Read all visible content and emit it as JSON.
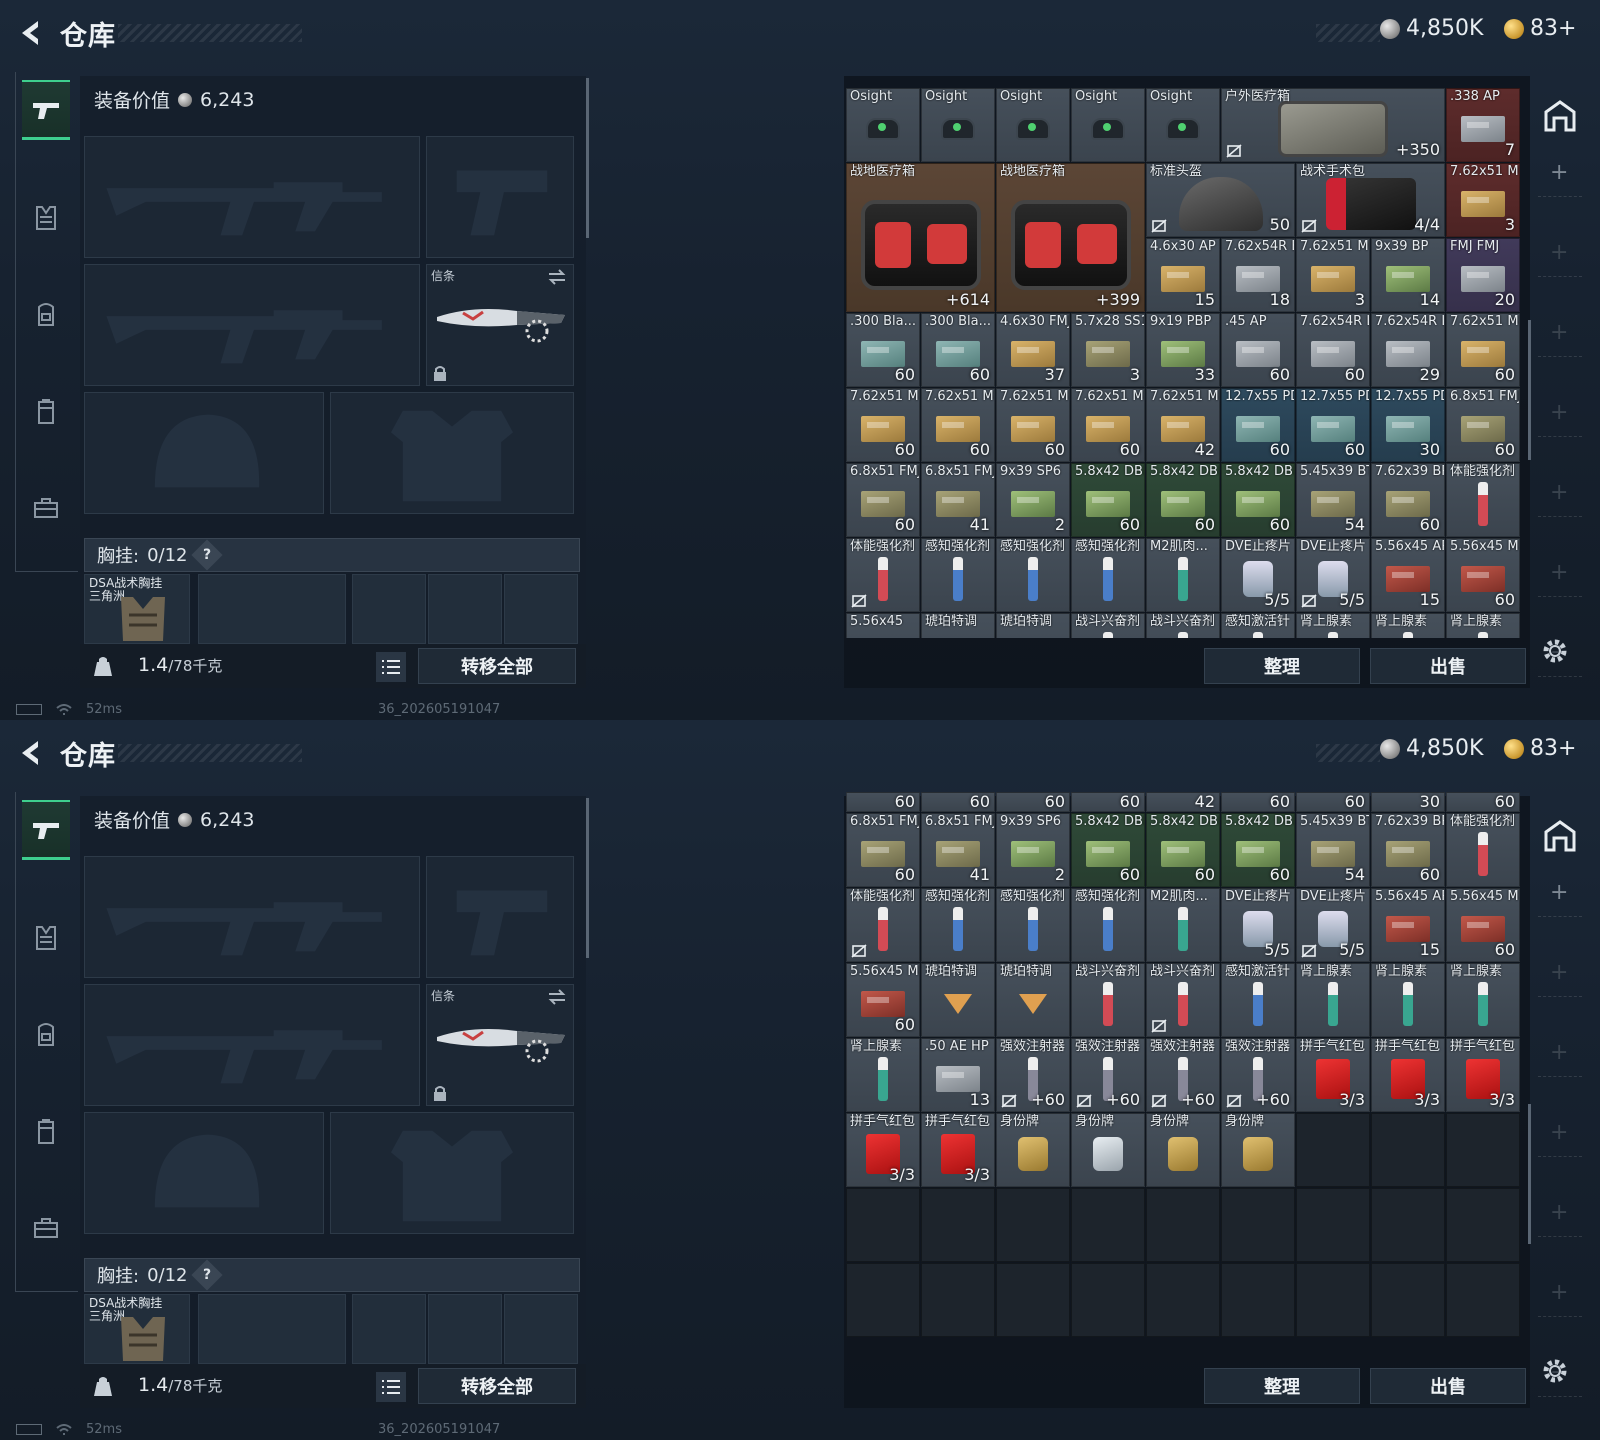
{
  "header": {
    "title": "仓库",
    "silver": "4,850K",
    "gold": "83+"
  },
  "equipment": {
    "value_label": "装备价值",
    "value": "6,243",
    "melee_label": "信条",
    "chest_label": "胸挂:",
    "chest_count": "0/12",
    "chest_help": "?",
    "rig_name": "DSA战术胸挂",
    "rig_sub": "三角洲",
    "weight": "1.4",
    "weight_max": "/78千克",
    "transfer_all": "转移全部"
  },
  "stash": {
    "sort_button": "整理",
    "sell_button": "出售"
  },
  "status": {
    "ping": "52ms",
    "build": "36_202605191047"
  },
  "stash_view_1": [
    {
      "r": 0,
      "c": 0,
      "n": "Osight",
      "i": "optic",
      "bg": "gray"
    },
    {
      "r": 0,
      "c": 1,
      "n": "Osight",
      "i": "optic",
      "bg": "gray"
    },
    {
      "r": 0,
      "c": 2,
      "n": "Osight",
      "i": "optic",
      "bg": "gray"
    },
    {
      "r": 0,
      "c": 3,
      "n": "Osight",
      "i": "optic",
      "bg": "gray"
    },
    {
      "r": 0,
      "c": 4,
      "n": "Osight",
      "i": "optic",
      "bg": "gray"
    },
    {
      "r": 0,
      "c": 5,
      "w": 3,
      "n": "户外医疗箱",
      "i": "case",
      "bg": "gray",
      "ct": "+350",
      "nk": true
    },
    {
      "r": 0,
      "c": 8,
      "n": ".338 AP",
      "i": "ammo-gray",
      "bg": "red",
      "ct": "7"
    },
    {
      "r": 1,
      "c": 0,
      "w": 2,
      "h": 2,
      "n": "战地医疗箱",
      "i": "bigmed",
      "bg": "brown",
      "ct": "+614"
    },
    {
      "r": 1,
      "c": 2,
      "w": 2,
      "h": 2,
      "n": "战地医疗箱",
      "i": "bigmed",
      "bg": "brown",
      "ct": "+399"
    },
    {
      "r": 1,
      "c": 4,
      "w": 2,
      "n": "标准头盔",
      "i": "helmet",
      "bg": "gray",
      "ct": "50",
      "nk": true
    },
    {
      "r": 1,
      "c": 6,
      "w": 2,
      "n": "战术手术包",
      "i": "kit",
      "bg": "gray",
      "ct": "4/4",
      "nk": true
    },
    {
      "r": 1,
      "c": 8,
      "n": "7.62x51 M61",
      "i": "ammo-tan",
      "bg": "red",
      "ct": "3"
    },
    {
      "r": 2,
      "c": 4,
      "n": "4.6x30 AP SX",
      "i": "ammo-tan",
      "bg": "gray",
      "ct": "15"
    },
    {
      "r": 2,
      "c": 5,
      "n": "7.62x54R BT",
      "i": "ammo-gray",
      "bg": "gray",
      "ct": "18"
    },
    {
      "r": 2,
      "c": 6,
      "n": "7.62x51 M62",
      "i": "ammo-tan",
      "bg": "gray",
      "ct": "3"
    },
    {
      "r": 2,
      "c": 7,
      "n": "9x39 BP",
      "i": "ammo-green",
      "bg": "gray",
      "ct": "14"
    },
    {
      "r": 2,
      "c": 8,
      "n": "FMJ FMJ",
      "i": "ammo-gray",
      "bg": "purple",
      "ct": "20"
    },
    {
      "r": 3,
      "c": 0,
      "n": ".300 Bla... BCP FMJ",
      "i": "ammo-teal",
      "bg": "gray",
      "ct": "60"
    },
    {
      "r": 3,
      "c": 1,
      "n": ".300 Bla... BCP FMJ",
      "i": "ammo-teal",
      "bg": "gray",
      "ct": "60"
    },
    {
      "r": 3,
      "c": 2,
      "n": "4.6x30 FMJ SX",
      "i": "ammo-tan",
      "bg": "gray",
      "ct": "37"
    },
    {
      "r": 3,
      "c": 3,
      "n": "5.7x28 SS190",
      "i": "ammo-olive",
      "bg": "gray",
      "ct": "3"
    },
    {
      "r": 3,
      "c": 4,
      "n": "9x19 PBP",
      "i": "ammo-green",
      "bg": "gray",
      "ct": "33"
    },
    {
      "r": 3,
      "c": 5,
      "n": ".45 AP",
      "i": "ammo-gray",
      "bg": "gray",
      "ct": "60"
    },
    {
      "r": 3,
      "c": 6,
      "n": "7.62x54R LPS",
      "i": "ammo-gray",
      "bg": "gray",
      "ct": "60"
    },
    {
      "r": 3,
      "c": 7,
      "n": "7.62x54R LPS",
      "i": "ammo-gray",
      "bg": "gray",
      "ct": "29"
    },
    {
      "r": 3,
      "c": 8,
      "n": "7.62x51 M80",
      "i": "ammo-tan",
      "bg": "gray",
      "ct": "60"
    },
    {
      "r": 4,
      "c": 0,
      "n": "7.62x51 M80",
      "i": "ammo-tan",
      "bg": "gray",
      "ct": "60"
    },
    {
      "r": 4,
      "c": 1,
      "n": "7.62x51 M80",
      "i": "ammo-tan",
      "bg": "gray",
      "ct": "60"
    },
    {
      "r": 4,
      "c": 2,
      "n": "7.62x51 M80",
      "i": "ammo-tan",
      "bg": "gray",
      "ct": "60"
    },
    {
      "r": 4,
      "c": 3,
      "n": "7.62x51 M80",
      "i": "ammo-tan",
      "bg": "gray",
      "ct": "60"
    },
    {
      "r": 4,
      "c": 4,
      "n": "7.62x51 M80",
      "i": "ammo-tan",
      "bg": "gray",
      "ct": "42"
    },
    {
      "r": 4,
      "c": 5,
      "n": "12.7x55 PD12双头",
      "i": "ammo-teal",
      "bg": "blue",
      "ct": "60"
    },
    {
      "r": 4,
      "c": 6,
      "n": "12.7x55 PD12双头",
      "i": "ammo-teal",
      "bg": "blue",
      "ct": "60"
    },
    {
      "r": 4,
      "c": 7,
      "n": "12.7x55 PD12双头",
      "i": "ammo-teal",
      "bg": "blue",
      "ct": "30"
    },
    {
      "r": 4,
      "c": 8,
      "n": "6.8x51 FMJ",
      "i": "ammo-olive",
      "bg": "gray",
      "ct": "60"
    },
    {
      "r": 5,
      "c": 0,
      "n": "6.8x51 FMJ",
      "i": "ammo-olive",
      "bg": "gray",
      "ct": "60"
    },
    {
      "r": 5,
      "c": 1,
      "n": "6.8x51 FMJ",
      "i": "ammo-olive",
      "bg": "gray",
      "ct": "41"
    },
    {
      "r": 5,
      "c": 2,
      "n": "9x39 SP6",
      "i": "ammo-green",
      "bg": "gray",
      "ct": "2"
    },
    {
      "r": 5,
      "c": 3,
      "n": "5.8x42 DBP10",
      "i": "ammo-green",
      "bg": "green",
      "ct": "60"
    },
    {
      "r": 5,
      "c": 4,
      "n": "5.8x42 DBP10",
      "i": "ammo-green",
      "bg": "green",
      "ct": "60"
    },
    {
      "r": 5,
      "c": 5,
      "n": "5.8x42 DBP10",
      "i": "ammo-green",
      "bg": "green",
      "ct": "60"
    },
    {
      "r": 5,
      "c": 6,
      "n": "5.45x39 BT",
      "i": "ammo-olive",
      "bg": "gray",
      "ct": "54"
    },
    {
      "r": 5,
      "c": 7,
      "n": "7.62x39 BP",
      "i": "ammo-olive",
      "bg": "gray",
      "ct": "60"
    },
    {
      "r": 5,
      "c": 8,
      "n": "体能强化剂",
      "i": "syr-red",
      "bg": "gray"
    },
    {
      "r": 6,
      "c": 0,
      "n": "体能强化剂",
      "i": "syr-red",
      "bg": "gray",
      "nk": true
    },
    {
      "r": 6,
      "c": 1,
      "n": "感知强化剂",
      "i": "syr-blue",
      "bg": "gray"
    },
    {
      "r": 6,
      "c": 2,
      "n": "感知强化剂",
      "i": "syr-blue",
      "bg": "gray"
    },
    {
      "r": 6,
      "c": 3,
      "n": "感知强化剂",
      "i": "syr-blue",
      "bg": "gray"
    },
    {
      "r": 6,
      "c": 4,
      "n": "M2肌肉...",
      "i": "syr-teal",
      "bg": "gray"
    },
    {
      "r": 6,
      "c": 5,
      "n": "DVE止疼片",
      "i": "pill",
      "bg": "gray",
      "ct": "5/5"
    },
    {
      "r": 6,
      "c": 6,
      "n": "DVE止疼片",
      "i": "pill",
      "bg": "gray",
      "ct": "5/5",
      "nk": true
    },
    {
      "r": 6,
      "c": 7,
      "n": "5.56x45 APC",
      "i": "ammo-red",
      "bg": "gray",
      "ct": "15"
    },
    {
      "r": 6,
      "c": 8,
      "n": "5.56x45 M855",
      "i": "ammo-red",
      "bg": "gray",
      "ct": "60"
    },
    {
      "r": 7,
      "c": 0,
      "n": "5.56x45",
      "i": "ammo-red",
      "bg": "gray"
    },
    {
      "r": 7,
      "c": 1,
      "n": "琥珀特调",
      "i": "cocktail",
      "bg": "gray"
    },
    {
      "r": 7,
      "c": 2,
      "n": "琥珀特调",
      "i": "cocktail",
      "bg": "gray"
    },
    {
      "r": 7,
      "c": 3,
      "n": "战斗兴奋剂",
      "i": "syr-red",
      "bg": "gray"
    },
    {
      "r": 7,
      "c": 4,
      "n": "战斗兴奋剂",
      "i": "syr-red",
      "bg": "gray"
    },
    {
      "r": 7,
      "c": 5,
      "n": "感知激活针",
      "i": "syr-blue",
      "bg": "gray"
    },
    {
      "r": 7,
      "c": 6,
      "n": "肾上腺素",
      "i": "syr-teal",
      "bg": "gray"
    },
    {
      "r": 7,
      "c": 7,
      "n": "肾上腺素",
      "i": "syr-teal",
      "bg": "gray"
    },
    {
      "r": 7,
      "c": 8,
      "n": "肾上腺素",
      "i": "syr-teal",
      "bg": "gray"
    }
  ],
  "stash_view_2_partial": [
    "60",
    "60",
    "60",
    "60",
    "42",
    "60",
    "60",
    "30",
    "60"
  ],
  "stash_view_2": [
    {
      "r": 0,
      "c": 0,
      "n": "6.8x51 FMJ",
      "i": "ammo-olive",
      "bg": "gray",
      "ct": "60"
    },
    {
      "r": 0,
      "c": 1,
      "n": "6.8x51 FMJ",
      "i": "ammo-olive",
      "bg": "gray",
      "ct": "41"
    },
    {
      "r": 0,
      "c": 2,
      "n": "9x39 SP6",
      "i": "ammo-green",
      "bg": "gray",
      "ct": "2"
    },
    {
      "r": 0,
      "c": 3,
      "n": "5.8x42 DBP10",
      "i": "ammo-green",
      "bg": "green",
      "ct": "60"
    },
    {
      "r": 0,
      "c": 4,
      "n": "5.8x42 DBP10",
      "i": "ammo-green",
      "bg": "green",
      "ct": "60"
    },
    {
      "r": 0,
      "c": 5,
      "n": "5.8x42 DBP10",
      "i": "ammo-green",
      "bg": "green",
      "ct": "60"
    },
    {
      "r": 0,
      "c": 6,
      "n": "5.45x39 BT",
      "i": "ammo-olive",
      "bg": "gray",
      "ct": "54"
    },
    {
      "r": 0,
      "c": 7,
      "n": "7.62x39 BP",
      "i": "ammo-olive",
      "bg": "gray",
      "ct": "60"
    },
    {
      "r": 0,
      "c": 8,
      "n": "体能强化剂",
      "i": "syr-red",
      "bg": "gray"
    },
    {
      "r": 1,
      "c": 0,
      "n": "体能强化剂",
      "i": "syr-red",
      "bg": "gray",
      "nk": true
    },
    {
      "r": 1,
      "c": 1,
      "n": "感知强化剂",
      "i": "syr-blue",
      "bg": "gray"
    },
    {
      "r": 1,
      "c": 2,
      "n": "感知强化剂",
      "i": "syr-blue",
      "bg": "gray"
    },
    {
      "r": 1,
      "c": 3,
      "n": "感知强化剂",
      "i": "syr-blue",
      "bg": "gray"
    },
    {
      "r": 1,
      "c": 4,
      "n": "M2肌肉...",
      "i": "syr-teal",
      "bg": "gray"
    },
    {
      "r": 1,
      "c": 5,
      "n": "DVE止疼片",
      "i": "pill",
      "bg": "gray",
      "ct": "5/5"
    },
    {
      "r": 1,
      "c": 6,
      "n": "DVE止疼片",
      "i": "pill",
      "bg": "gray",
      "ct": "5/5",
      "nk": true
    },
    {
      "r": 1,
      "c": 7,
      "n": "5.56x45 APC",
      "i": "ammo-red",
      "bg": "gray",
      "ct": "15"
    },
    {
      "r": 1,
      "c": 8,
      "n": "5.56x45 M855",
      "i": "ammo-red",
      "bg": "gray",
      "ct": "60"
    },
    {
      "r": 2,
      "c": 0,
      "n": "5.56x45 M855",
      "i": "ammo-red",
      "bg": "gray",
      "ct": "60"
    },
    {
      "r": 2,
      "c": 1,
      "n": "琥珀特调",
      "i": "cocktail",
      "bg": "gray"
    },
    {
      "r": 2,
      "c": 2,
      "n": "琥珀特调",
      "i": "cocktail",
      "bg": "gray"
    },
    {
      "r": 2,
      "c": 3,
      "n": "战斗兴奋剂",
      "i": "syr-red",
      "bg": "gray"
    },
    {
      "r": 2,
      "c": 4,
      "n": "战斗兴奋剂",
      "i": "syr-red",
      "bg": "gray",
      "nk": true
    },
    {
      "r": 2,
      "c": 5,
      "n": "感知激活针",
      "i": "syr-blue",
      "bg": "gray"
    },
    {
      "r": 2,
      "c": 6,
      "n": "肾上腺素",
      "i": "syr-teal",
      "bg": "gray"
    },
    {
      "r": 2,
      "c": 7,
      "n": "肾上腺素",
      "i": "syr-teal",
      "bg": "gray"
    },
    {
      "r": 2,
      "c": 8,
      "n": "肾上腺素",
      "i": "syr-teal",
      "bg": "gray"
    },
    {
      "r": 3,
      "c": 0,
      "n": "肾上腺素",
      "i": "syr-teal",
      "bg": "gray"
    },
    {
      "r": 3,
      "c": 1,
      "n": ".50 AE HP",
      "i": "ammo-gray",
      "bg": "gray",
      "ct": "13"
    },
    {
      "r": 3,
      "c": 2,
      "n": "强效注射器",
      "i": "syr-gray",
      "bg": "gray",
      "ct": "+60",
      "nk": true
    },
    {
      "r": 3,
      "c": 3,
      "n": "强效注射器",
      "i": "syr-gray",
      "bg": "gray",
      "ct": "+60",
      "nk": true
    },
    {
      "r": 3,
      "c": 4,
      "n": "强效注射器",
      "i": "syr-gray",
      "bg": "gray",
      "ct": "+60",
      "nk": true
    },
    {
      "r": 3,
      "c": 5,
      "n": "强效注射器",
      "i": "syr-gray",
      "bg": "gray",
      "ct": "+60",
      "nk": true
    },
    {
      "r": 3,
      "c": 6,
      "n": "拼手气红包",
      "i": "env",
      "bg": "gray",
      "ct": "3/3"
    },
    {
      "r": 3,
      "c": 7,
      "n": "拼手气红包",
      "i": "env",
      "bg": "gray",
      "ct": "3/3"
    },
    {
      "r": 3,
      "c": 8,
      "n": "拼手气红包",
      "i": "env",
      "bg": "gray",
      "ct": "3/3"
    },
    {
      "r": 4,
      "c": 0,
      "n": "拼手气红包",
      "i": "env",
      "bg": "gray",
      "ct": "3/3"
    },
    {
      "r": 4,
      "c": 1,
      "n": "拼手气红包",
      "i": "env",
      "bg": "gray",
      "ct": "3/3"
    },
    {
      "r": 4,
      "c": 2,
      "n": "身份牌",
      "i": "tag",
      "bg": "gray"
    },
    {
      "r": 4,
      "c": 3,
      "n": "身份牌",
      "i": "tag-sv",
      "bg": "gray"
    },
    {
      "r": 4,
      "c": 4,
      "n": "身份牌",
      "i": "tag",
      "bg": "gray"
    },
    {
      "r": 4,
      "c": 5,
      "n": "身份牌",
      "i": "tag",
      "bg": "gray"
    }
  ]
}
